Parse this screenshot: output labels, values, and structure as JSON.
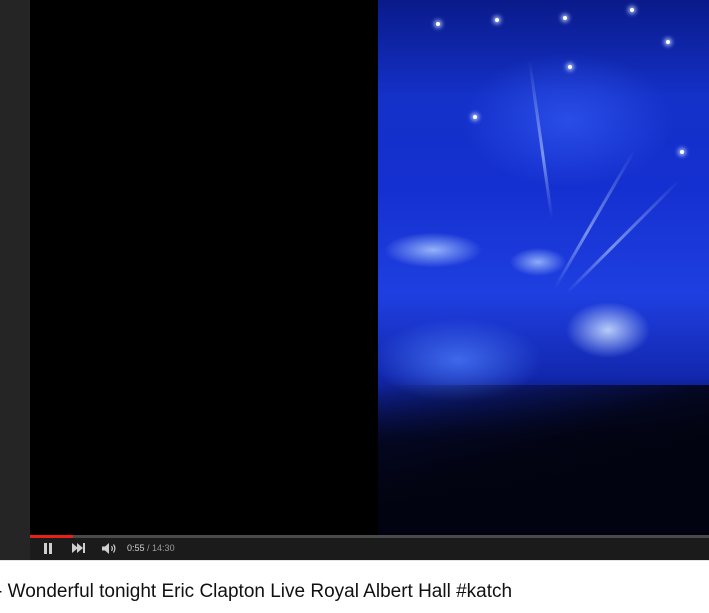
{
  "player": {
    "current_time": "0:55",
    "separator": " / ",
    "duration": "14:30",
    "progress_fraction": 0.063,
    "accent_color": "#e62117"
  },
  "controls": {
    "play_pause_icon": "pause-icon",
    "next_icon": "skip-next-icon",
    "volume_icon": "volume-icon"
  },
  "video": {
    "title": "- Wonderful tonight Eric Clapton Live Royal Albert Hall #katch"
  }
}
